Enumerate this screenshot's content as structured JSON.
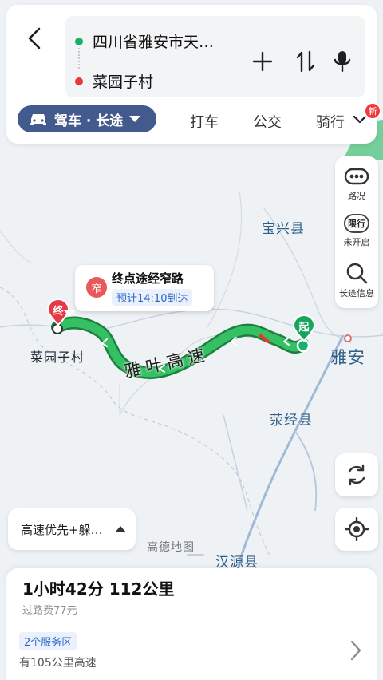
{
  "route": {
    "start_text": "四川省雅安市天…",
    "end_text": "菜园子村"
  },
  "modes": {
    "active_label": "驾车 · 长途",
    "taxi": "打车",
    "bus": "公交",
    "bike": "骑行",
    "new_badge": "新"
  },
  "tools": {
    "traffic": "路况",
    "restriction_icon": "限行",
    "restriction": "未开启",
    "longtrip": "长途信息"
  },
  "map": {
    "baoxing": "宝兴县",
    "yingjing": "荥经县",
    "yaan": "雅安",
    "hanyuan": "汉源县",
    "caiyuanzi": "菜园子村",
    "road": "雅叶高速",
    "start_pin": "起",
    "end_pin": "终",
    "watermark": "高德地图"
  },
  "popup": {
    "badge": "窄",
    "title": "终点途经窄路",
    "eta": "预计14:10到达"
  },
  "option": {
    "label": "高速优先+躲…"
  },
  "summary": {
    "time_distance": "1小时42分  112公里",
    "toll": "过路费77元",
    "service": "2个服务区",
    "highway": "有105公里高速"
  },
  "colors": {
    "route": "#2bb55a",
    "route_dark": "#1f8f45",
    "accent": "#435a8c",
    "start_dot": "#17b26a",
    "end_dot": "#e53935"
  }
}
